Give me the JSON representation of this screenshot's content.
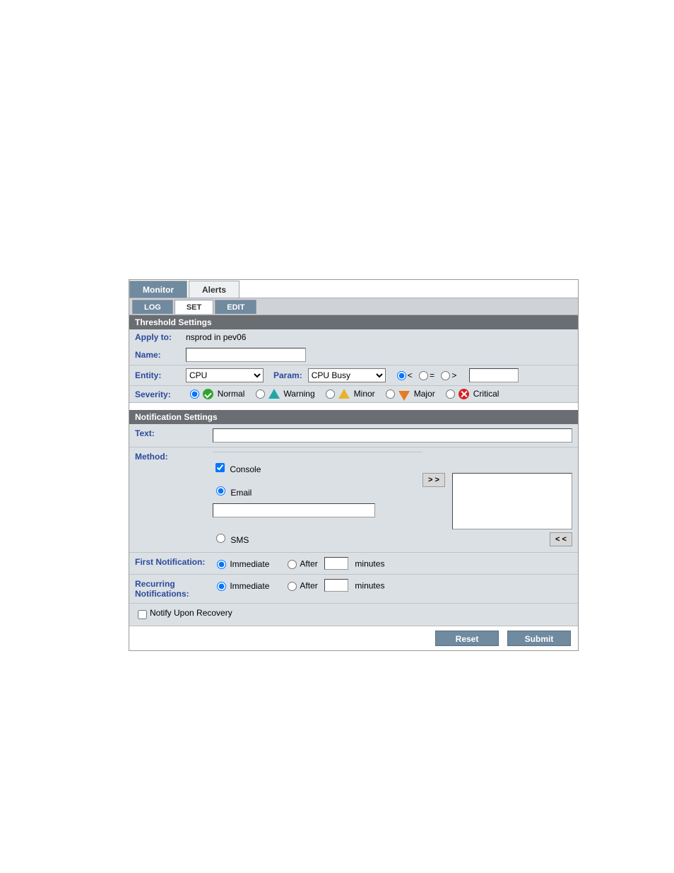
{
  "tabs": {
    "monitor": "Monitor",
    "alerts": "Alerts"
  },
  "subtabs": {
    "log": "LOG",
    "set": "SET",
    "edit": "EDIT"
  },
  "threshold": {
    "header": "Threshold Settings",
    "applyto_label": "Apply to:",
    "applyto_value": "nsprod in pev06",
    "name_label": "Name:",
    "name_value": "",
    "entity_label": "Entity:",
    "entity_value": "CPU",
    "param_label": "Param:",
    "param_value": "CPU Busy",
    "operator_lt": "<",
    "operator_eq": "=",
    "operator_gt": ">",
    "threshold_value": "",
    "severity_label": "Severity:",
    "sev_normal": "Normal",
    "sev_warning": "Warning",
    "sev_minor": "Minor",
    "sev_major": "Major",
    "sev_critical": "Critical"
  },
  "notification": {
    "header": "Notification Settings",
    "text_label": "Text:",
    "text_value": "",
    "method_label": "Method:",
    "console": "Console",
    "email": "Email",
    "email_value": "",
    "sms": "SMS",
    "move_right": "> >",
    "move_left": "< <",
    "first_label": "First Notification:",
    "recurring_label": "Recurring Notifications:",
    "immediate": "Immediate",
    "after": "After",
    "minutes": "minutes",
    "first_minutes_value": "",
    "recurring_minutes_value": "",
    "notify_recovery": "Notify Upon Recovery"
  },
  "buttons": {
    "reset": "Reset",
    "submit": "Submit"
  }
}
